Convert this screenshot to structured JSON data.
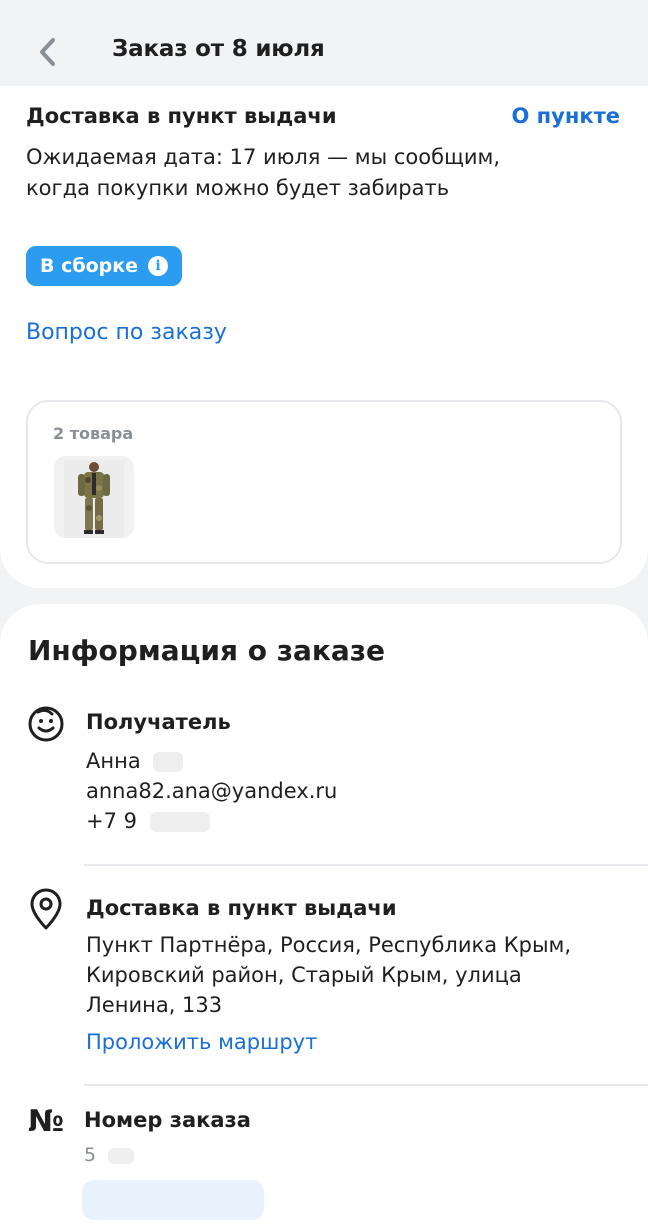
{
  "header": {
    "back_icon": "chevron-left-icon",
    "title": "Заказ от 8 июля"
  },
  "delivery": {
    "title": "Доставка в пункт выдачи",
    "about_link": "О пункте",
    "expected_text": "Ожидаемая дата: 17 июля — мы сообщим, когда покупки можно будет забирать",
    "status_label": "В сборке",
    "status_color": "#2b9cf0",
    "question_link": "Вопрос по заказу"
  },
  "items": {
    "count_label": "2 товара"
  },
  "info": {
    "heading": "Информация о заказе",
    "recipient": {
      "title": "Получатель",
      "name": "Анна",
      "email": "anna82.ana@yandex.ru",
      "phone": "+7 9"
    },
    "pickup": {
      "title": "Доставка в пункт выдачи",
      "address_lines": [
        "Пункт Партнёра, Россия, Республика Крым,",
        "Кировский район, Старый Крым, улица",
        "Ленина, 133"
      ],
      "route_link": "Проложить маршрут"
    },
    "order_number": {
      "icon_glyph": "№",
      "title": "Номер заказа",
      "value": "5"
    }
  },
  "colors": {
    "link": "#1a6fd6",
    "background": "#f2f3f5"
  }
}
